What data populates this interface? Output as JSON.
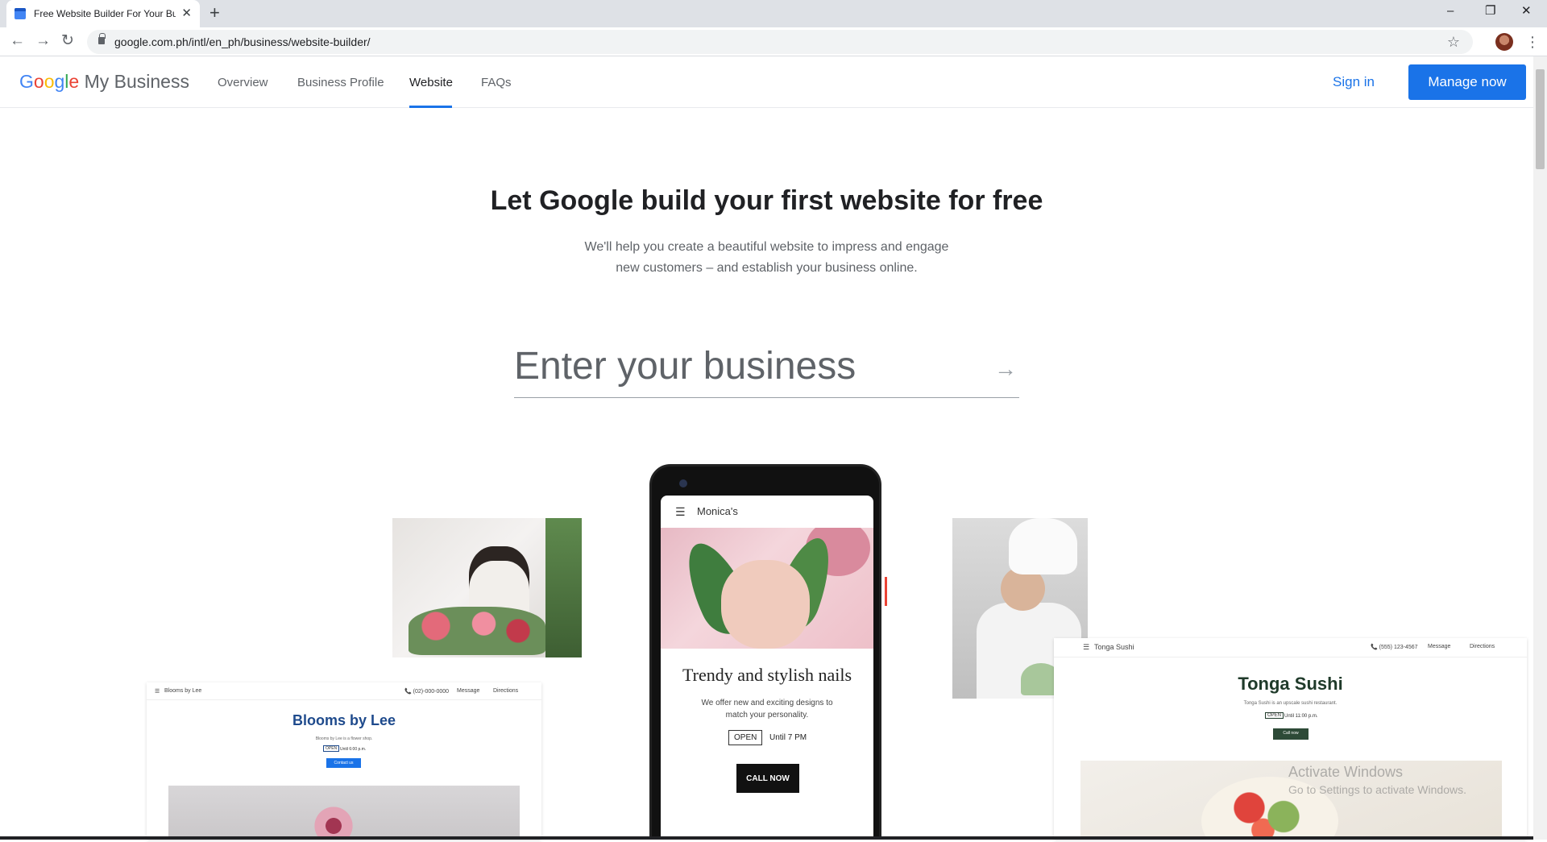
{
  "browser": {
    "tab_title": "Free Website Builder For Your Bu",
    "new_tab": "+",
    "tab_close": "✕",
    "url": "google.com.ph/intl/en_ph/business/website-builder/",
    "minimize": "–",
    "restore": "❐",
    "close": "✕",
    "back": "←",
    "forward": "→",
    "reload": "↻",
    "bookmark": "☆",
    "menu": "⋮"
  },
  "header": {
    "logo_google": [
      "G",
      "o",
      "o",
      "g",
      "l",
      "e"
    ],
    "logo_rest": "My Business",
    "nav": [
      "Overview",
      "Business Profile",
      "Website",
      "FAQs"
    ],
    "active_nav": "Website",
    "sign_in": "Sign in",
    "manage_now": "Manage now"
  },
  "hero": {
    "title": "Let Google build your first website for free",
    "subtitle_line1": "We'll help you create a beautiful website to impress and engage",
    "subtitle_line2": "new customers – and establish your business online.",
    "input_placeholder": "Enter your business",
    "submit_icon": "→"
  },
  "phone": {
    "menu_icon": "☰",
    "business_name": "Monica's",
    "headline": "Trendy and stylish nails",
    "description": "We offer new and exciting designs to match your personality.",
    "open_badge": "OPEN",
    "hours": "Until 7 PM",
    "cta": "CALL NOW"
  },
  "blooms_card": {
    "nav_name": "Blooms by Lee",
    "nav_phone": "📞 (02)-000-0000",
    "nav_message": "Message",
    "nav_directions": "Directions",
    "title": "Blooms by Lee",
    "description": "Blooms by Lee is a flower shop.",
    "open_badge": "OPEN",
    "hours": "Until 6:00 p.m.",
    "cta": "Contact us",
    "accent": "#1e4a8c",
    "button_color": "#1a73e8"
  },
  "tonga_card": {
    "nav_name": "Tonga Sushi",
    "nav_phone": "📞 (555) 123-4567",
    "nav_message": "Message",
    "nav_directions": "Directions",
    "title": "Tonga Sushi",
    "description": "Tonga Sushi is an upscale sushi restaurant.",
    "open_badge": "OPEN",
    "hours": "Until 11:00 p.m.",
    "cta": "Call now",
    "accent": "#1f3a2a",
    "button_color": "#2d4a37"
  },
  "watermark": {
    "line1": "Activate Windows",
    "line2": "Go to Settings to activate Windows."
  }
}
